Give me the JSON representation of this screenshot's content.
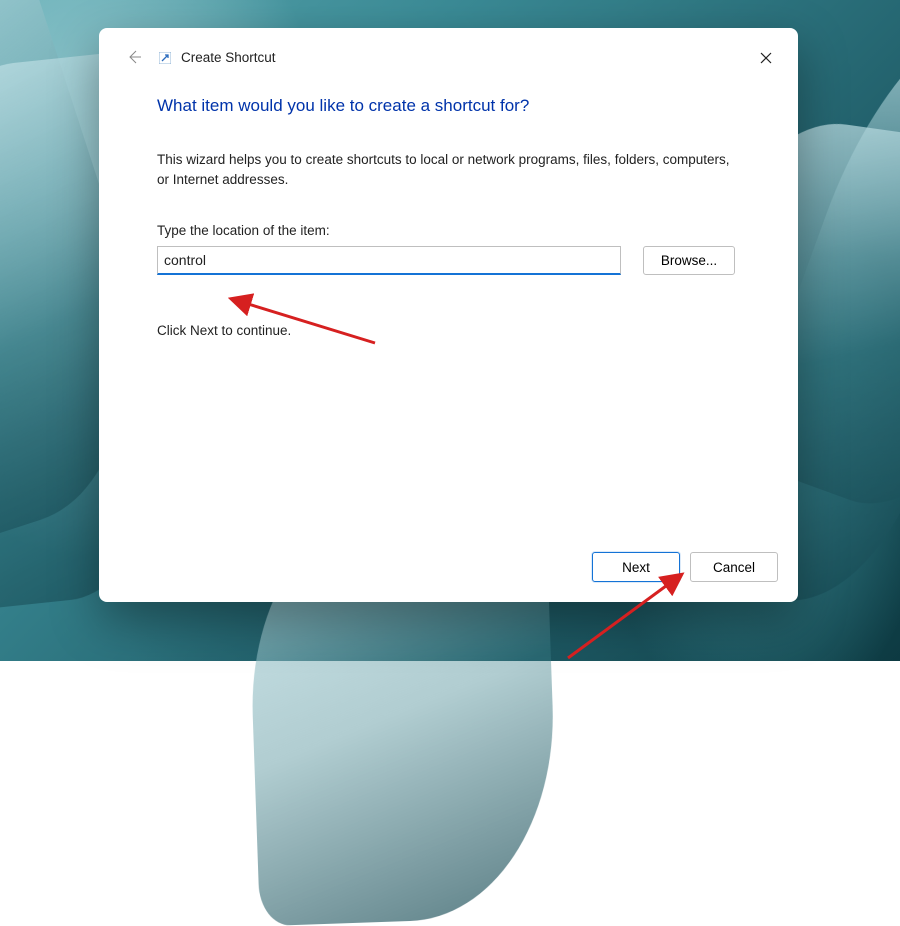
{
  "dialog": {
    "title": "Create Shortcut",
    "heading": "What item would you like to create a shortcut for?",
    "description": "This wizard helps you to create shortcuts to local or network programs, files, folders, computers, or Internet addresses.",
    "field_label": "Type the location of the item:",
    "location_value": "control",
    "browse_label": "Browse...",
    "continue_text": "Click Next to continue.",
    "next_label": "Next",
    "cancel_label": "Cancel"
  },
  "colors": {
    "accent": "#1473d6",
    "heading": "#0033aa",
    "annotation": "#d62020"
  }
}
